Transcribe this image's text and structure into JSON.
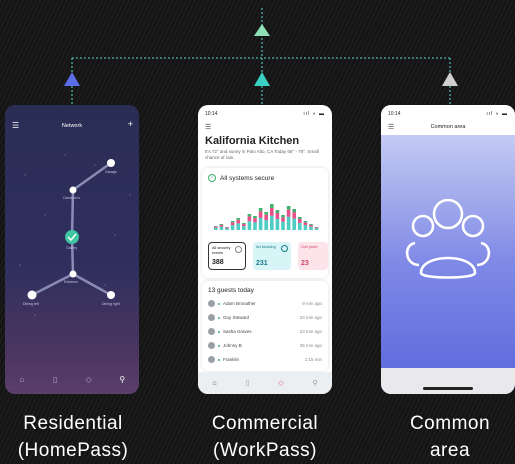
{
  "colors": {
    "connector": "#48b5a8",
    "arrow_left": "#5a6ee8",
    "arrow_mid": "#3ad0c4",
    "arrow_top": "#8fe0b4",
    "arrow_right": "#cfcfcf"
  },
  "phones": {
    "residential": {
      "title": "Network",
      "nodes": [
        "Garage",
        "Cameron's",
        "Gallery",
        "Entrance",
        "Dining left",
        "Dining right"
      ]
    },
    "commercial": {
      "time": "10:14",
      "title": "Kalifornia Kitchen",
      "subtitle": "It's 72° and sunny in Palo Alto, CA Today 68° - 79°. Small chance of rain.",
      "secure_label": "All systems secure",
      "stats": [
        {
          "label": "All security events",
          "value": "388"
        },
        {
          "label": "Ad blocking",
          "value": "231"
        },
        {
          "label": "Onli prote",
          "value": "23"
        }
      ],
      "guests_title": "13 guests today",
      "guests": [
        {
          "name": "Adam Bronather",
          "time": "9 min ago"
        },
        {
          "name": "Guy Steward",
          "time": "23 min ago"
        },
        {
          "name": "Sasha Graves",
          "time": "23 min ago"
        },
        {
          "name": "Johnny B",
          "time": "35 min ago"
        },
        {
          "name": "Franklin",
          "time": "1:15 min"
        }
      ]
    },
    "common": {
      "time": "10:14",
      "title": "Common area"
    }
  },
  "captions": {
    "residential_line1": "Residential",
    "residential_line2": "(HomePass)",
    "commercial_line1": "Commercial",
    "commercial_line2": "(WorkPass)",
    "common_line1": "Common",
    "common_line2": "area"
  }
}
